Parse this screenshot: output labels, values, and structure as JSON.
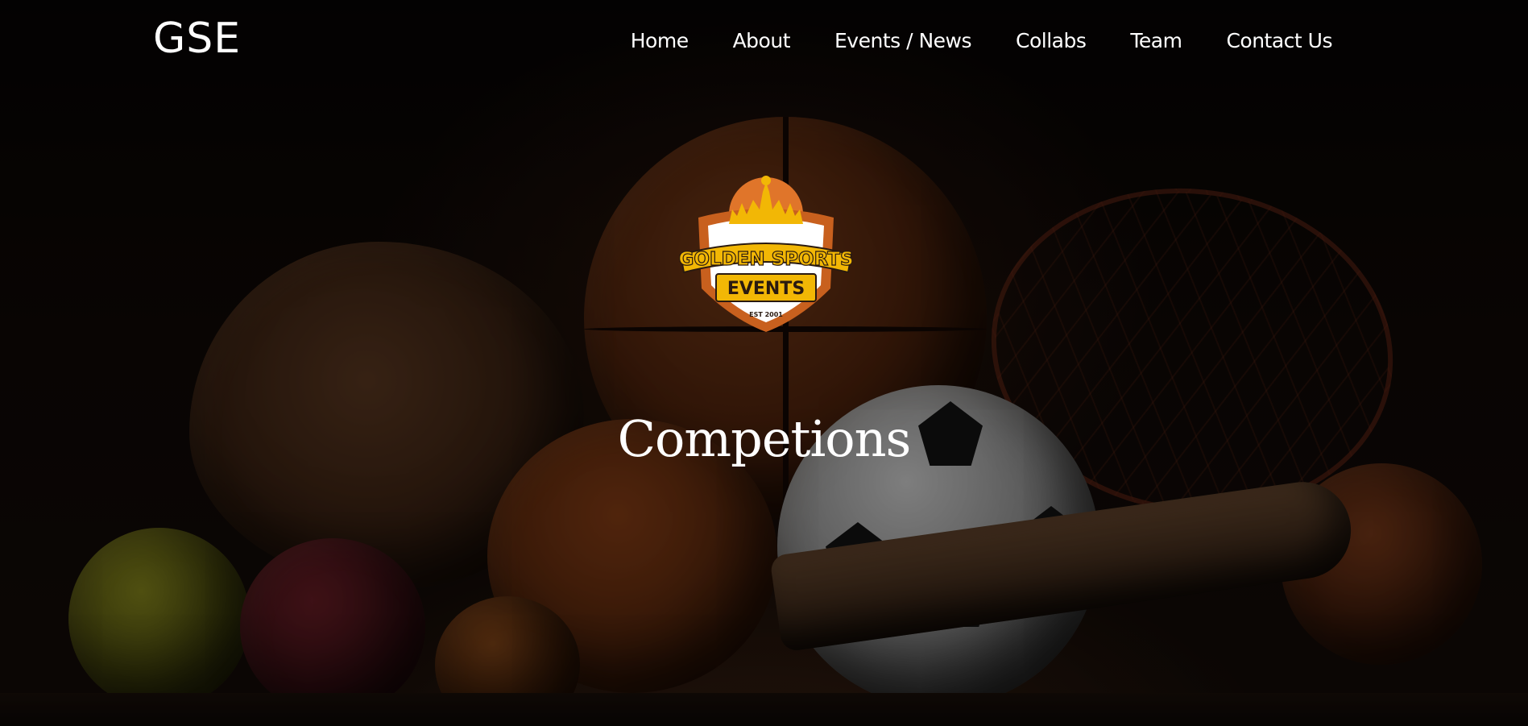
{
  "nav": {
    "brand": "GSE",
    "links": [
      {
        "label": "Home"
      },
      {
        "label": "About"
      },
      {
        "label": "Events / News"
      },
      {
        "label": "Collabs"
      },
      {
        "label": "Team"
      },
      {
        "label": "Contact Us"
      }
    ]
  },
  "logo": {
    "line1": "GOLDEN SPORTS",
    "line2": "EVENTS",
    "established": "EST 2001",
    "colors": {
      "orange": "#e0752a",
      "gold": "#f2b705",
      "dark": "#2a1a10"
    }
  },
  "hero": {
    "title": "Competions"
  }
}
